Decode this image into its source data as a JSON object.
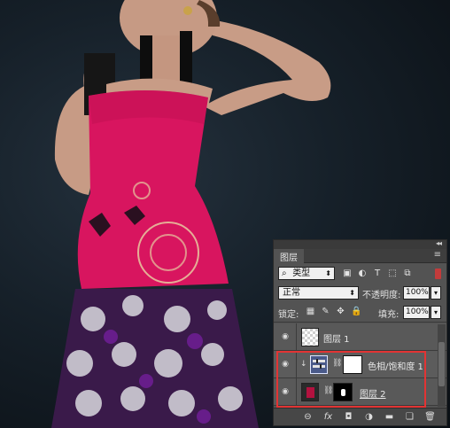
{
  "panel": {
    "collapse_glyph": "◂◂",
    "close_glyph": "×",
    "tab_label": "图层",
    "menu_glyph": "≡",
    "filter": {
      "label": "类型",
      "search_glyph": "⌕"
    },
    "blend_mode": "正常",
    "opacity_label": "不透明度:",
    "opacity_value": "100%",
    "lock_label": "锁定:",
    "fill_label": "填充:",
    "fill_value": "100%"
  },
  "layers": [
    {
      "name": "图层 1",
      "type": "pixel"
    },
    {
      "name": "色相/饱和度 1",
      "type": "adjustment-hue-saturation"
    },
    {
      "name": "图层 2",
      "type": "pixel-with-mask"
    }
  ],
  "icons": {
    "filter_pixel": "▣",
    "filter_adjust": "◐",
    "filter_text": "T",
    "filter_shape": "⬚",
    "filter_smart": "⧉",
    "lock_pixels": "▦",
    "lock_paint": "✎",
    "lock_move": "✥",
    "lock_all": "🔒",
    "eye": "◉",
    "chain": "⛓",
    "clip": "↓",
    "link": "⊖",
    "fx": "fx",
    "mask": "◘",
    "adjustment": "◑",
    "group": "▬",
    "new_layer": "❏",
    "delete": "🗑"
  },
  "colors": {
    "highlight": "#e23434",
    "panel_bg": "#535353"
  }
}
